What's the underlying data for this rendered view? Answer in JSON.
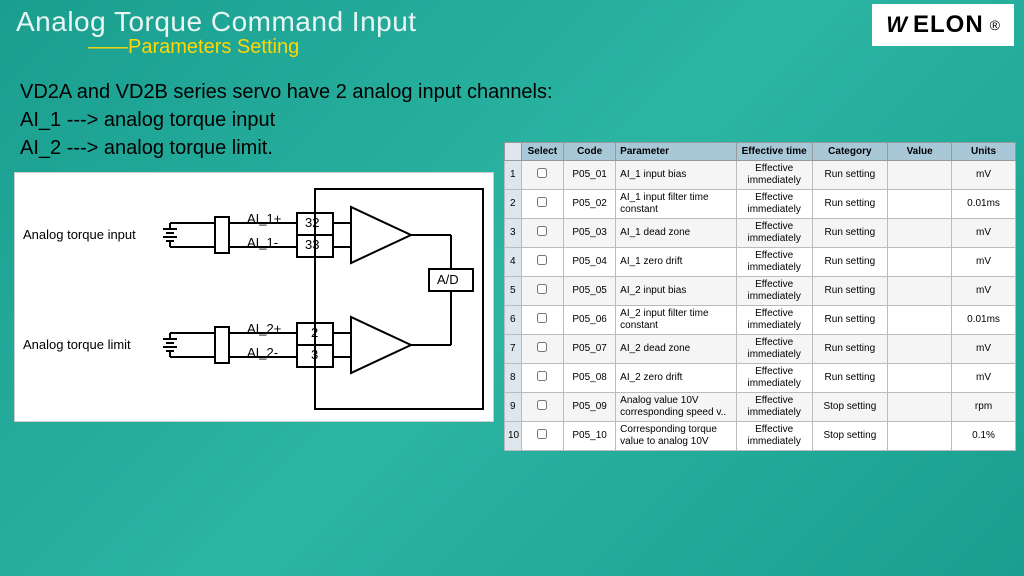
{
  "header": {
    "title": "Analog Torque Command Input",
    "subtitle": "——Parameters Setting",
    "logo_text": "ELON"
  },
  "intro": {
    "line1": "VD2A and VD2B series servo have 2 analog input channels:",
    "line2": "AI_1 ---> analog torque input",
    "line3": "AI_2 ---> analog torque limit."
  },
  "diagram": {
    "label1": "Analog torque input",
    "label2": "Analog torque limit",
    "sig1p": "AI_1+",
    "pin1": "32",
    "sig1n": "AI_1-",
    "pin2": "33",
    "sig2p": "AI_2+",
    "pin3": "2",
    "sig2n": "AI_2-",
    "pin4": "3",
    "ad": "A/D"
  },
  "table": {
    "headers": [
      "Select",
      "Code",
      "Parameter",
      "Effective time",
      "Category",
      "Value",
      "Units"
    ],
    "rows": [
      {
        "n": "1",
        "code": "P05_01",
        "param": "AI_1 input bias",
        "eff": "Effective immediately",
        "cat": "Run setting",
        "val": "",
        "unit": "mV"
      },
      {
        "n": "2",
        "code": "P05_02",
        "param": "AI_1 input filter time constant",
        "eff": "Effective immediately",
        "cat": "Run setting",
        "val": "",
        "unit": "0.01ms"
      },
      {
        "n": "3",
        "code": "P05_03",
        "param": "AI_1 dead zone",
        "eff": "Effective immediately",
        "cat": "Run setting",
        "val": "",
        "unit": "mV"
      },
      {
        "n": "4",
        "code": "P05_04",
        "param": "AI_1 zero drift",
        "eff": "Effective immediately",
        "cat": "Run setting",
        "val": "",
        "unit": "mV"
      },
      {
        "n": "5",
        "code": "P05_05",
        "param": "AI_2 input bias",
        "eff": "Effective immediately",
        "cat": "Run setting",
        "val": "",
        "unit": "mV"
      },
      {
        "n": "6",
        "code": "P05_06",
        "param": "AI_2 input filter time constant",
        "eff": "Effective immediately",
        "cat": "Run setting",
        "val": "",
        "unit": "0.01ms"
      },
      {
        "n": "7",
        "code": "P05_07",
        "param": "AI_2 dead zone",
        "eff": "Effective immediately",
        "cat": "Run setting",
        "val": "",
        "unit": "mV"
      },
      {
        "n": "8",
        "code": "P05_08",
        "param": "AI_2 zero drift",
        "eff": "Effective immediately",
        "cat": "Run setting",
        "val": "",
        "unit": "mV"
      },
      {
        "n": "9",
        "code": "P05_09",
        "param": "Analog value 10V corresponding speed v..",
        "eff": "Effective immediately",
        "cat": "Stop setting",
        "val": "",
        "unit": "rpm"
      },
      {
        "n": "10",
        "code": "P05_10",
        "param": "Corresponding torque value to analog 10V",
        "eff": "Effective immediately",
        "cat": "Stop setting",
        "val": "",
        "unit": "0.1%"
      }
    ]
  }
}
